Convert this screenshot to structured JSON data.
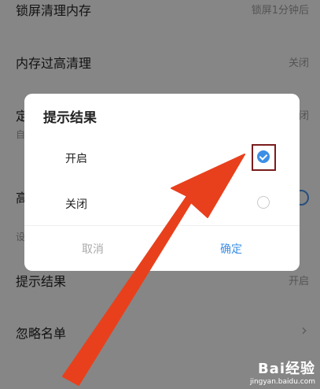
{
  "settings": {
    "rows": [
      {
        "title": "锁屏清理内存",
        "value": "锁屏1分钟后"
      },
      {
        "title": "内存过高清理",
        "value": "关闭"
      },
      {
        "title": "定",
        "value": "闭"
      },
      {
        "hint": "自"
      },
      {
        "title": "高"
      },
      {
        "hint": "设"
      },
      {
        "title": "提示结果",
        "value": "开启"
      },
      {
        "title": "忽略名单",
        "value": "›"
      }
    ]
  },
  "dialog": {
    "title": "提示结果",
    "options": [
      {
        "label": "开启",
        "selected": true
      },
      {
        "label": "关闭",
        "selected": false
      }
    ],
    "cancel": "取消",
    "confirm": "确定"
  },
  "annotation": {
    "arrow_color": "#e8401c",
    "box_color": "#7a1d1d"
  },
  "watermark": {
    "brand": "Bai经验",
    "url": "jingyan.baidu.com"
  },
  "colors": {
    "accent": "#3b8fe6"
  }
}
